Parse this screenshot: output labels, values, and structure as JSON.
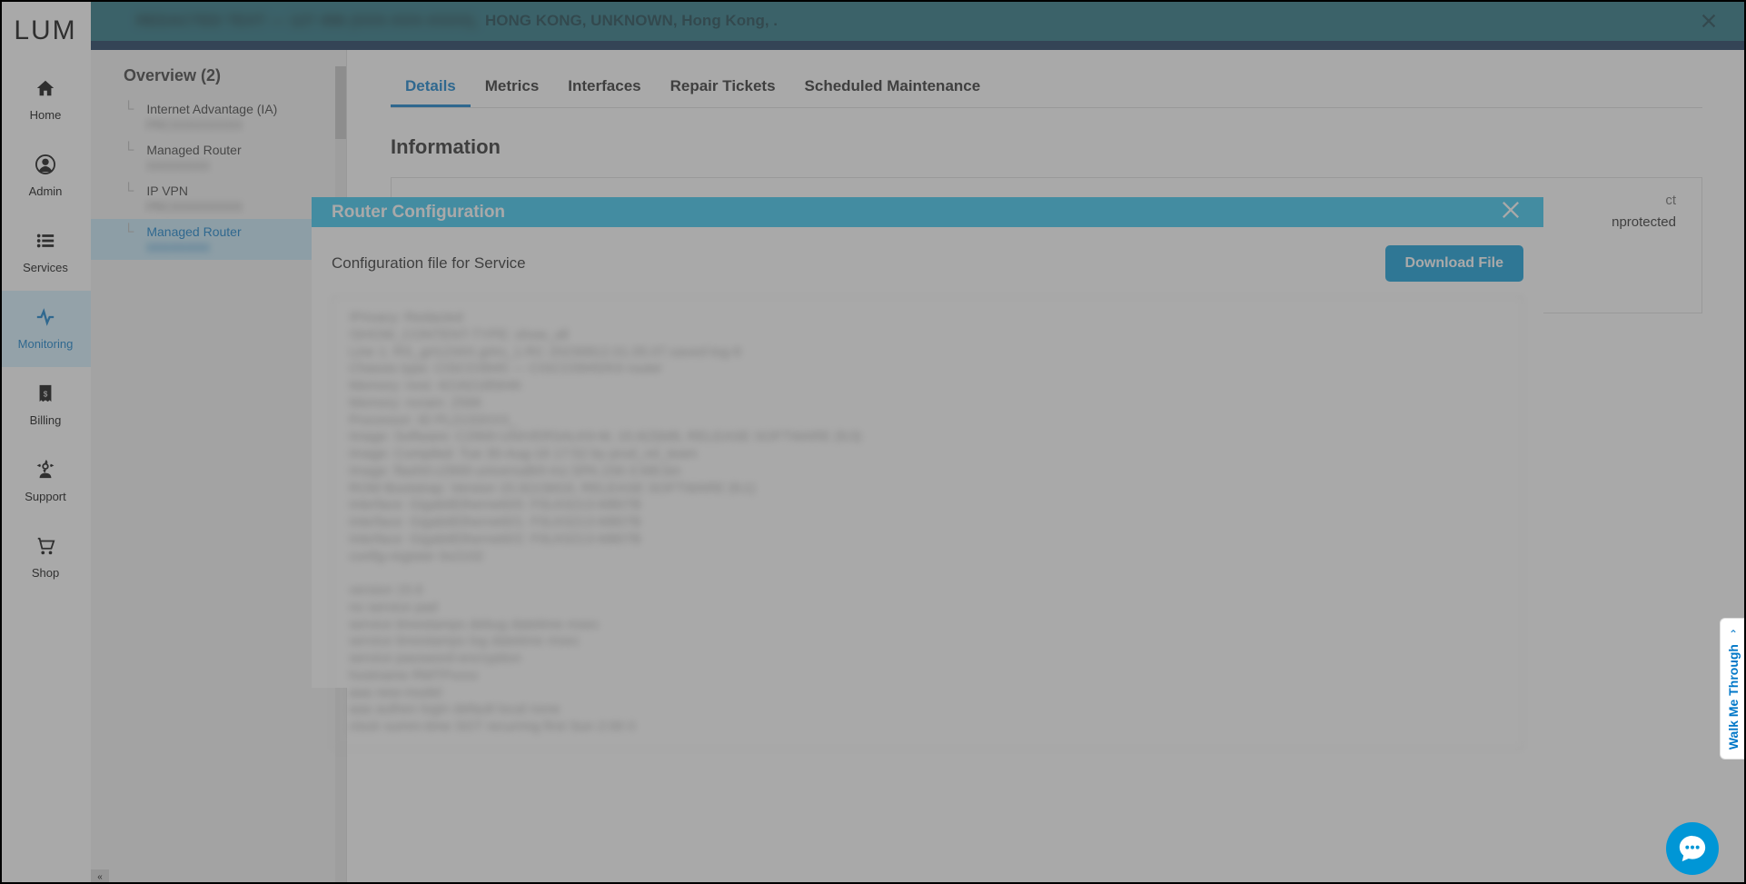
{
  "banner": {
    "redacted": "REDACTED TEXT — 127 456 (XXX-XXX-XXXX), ",
    "location": "HONG KONG, UNKNOWN, Hong Kong, ."
  },
  "logo": "LUM",
  "sidebar": {
    "items": [
      {
        "label": "Home"
      },
      {
        "label": "Admin"
      },
      {
        "label": "Services"
      },
      {
        "label": "Monitoring"
      },
      {
        "label": "Billing"
      },
      {
        "label": "Support"
      },
      {
        "label": "Shop"
      }
    ]
  },
  "tree": {
    "title": "Overview (2)",
    "items": [
      {
        "label": "Internet Advantage (IA)",
        "sub": "PRCXXXXXXXXX"
      },
      {
        "label": "Managed Router",
        "sub": "XXXXXXXX"
      },
      {
        "label": "IP VPN",
        "sub": "PRCXXXXXXXXX"
      },
      {
        "label": "Managed Router",
        "sub": "XXXXXXXX"
      }
    ]
  },
  "tabs": [
    "Details",
    "Metrics",
    "Interfaces",
    "Repair Tickets",
    "Scheduled Maintenance"
  ],
  "main": {
    "section_heading": "Information",
    "info_label": "ct",
    "info_value": "nprotected"
  },
  "modal": {
    "title": "Router Configuration",
    "subtitle": "Configuration file for Service",
    "download": "Download File",
    "config_text": "!Privacy: Redacted\n!SHOW_CONTENT-TYPE: show_all\nLine 1: RS_grt1234X.grtrs_1.RC 20230812.01.05.07.saved-log-8\nChassis type: CISCO3945 — CISCO3945/K9 router\nMemory: nvsi: 4216218564K\nMemory: nvram: 256K\nProcessor: ID PL2133XXX_\nImage: Software: C2900-UNIVERSALK9-M, 15.6(3)M8, RELEASE SOFTWARE (fc3)\nImage: Compiled: Tue 30-Aug-16 17:52 by prod_rel_team\nImage: flash0:c2900-universalk9-mz.SPA.156-3.M8.bin\nROM Bootstrap: Version 15.0(1r)M16, RELEASE SOFTWARE (fc1)\nInterface: GigabitEthernet0/0: F0LK0213-M807B\nInterface: GigabitEthernet0/1: F0LK0213-M807B\nInterface: GigabitEthernet0/2: F0LK0213-M807B\nconfig-register 0x2102\n\nversion 15.6\nno service pad\nservice timestamps debug datetime msec\nservice timestamps log datetime msec\nservice password-encryption\nhostname RMTPxxxx\naaa new-model\naaa authen login default local none\nclock summ-time SGT recurring first Sun 2:00 0\n"
  },
  "walk_me": "Walk Me Through"
}
